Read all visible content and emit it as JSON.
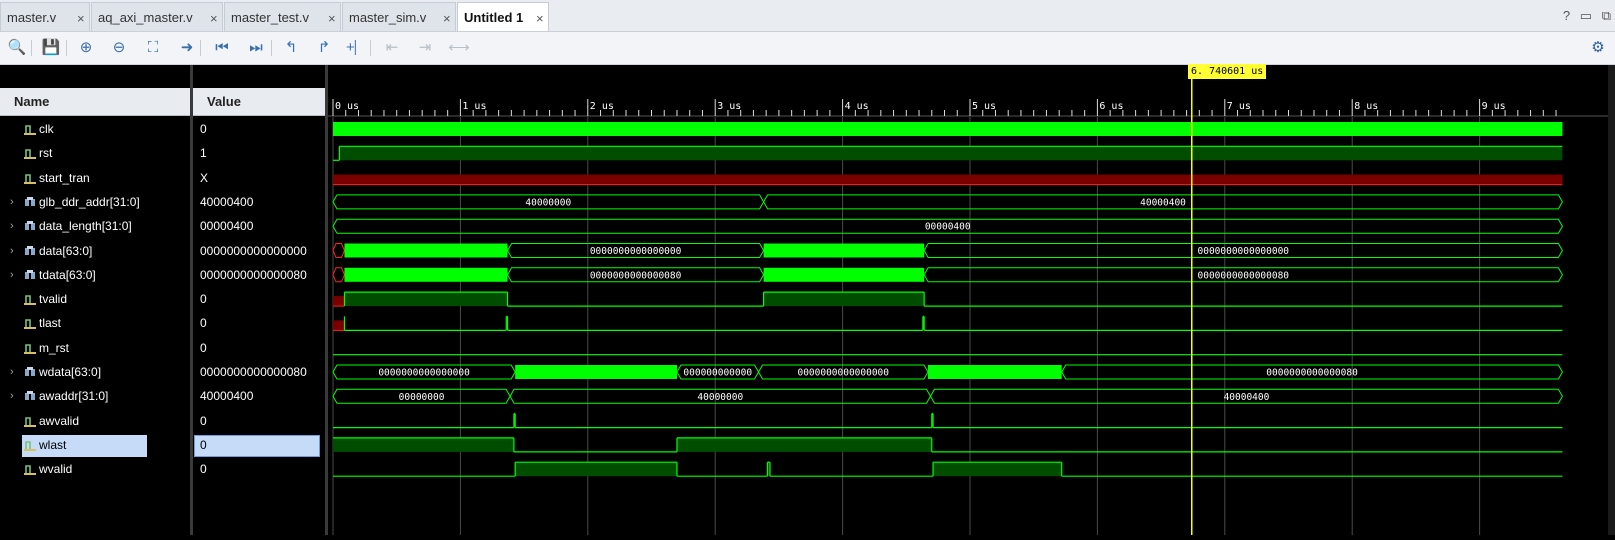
{
  "tabs": [
    {
      "label": "master.v",
      "active": false
    },
    {
      "label": "aq_axi_master.v",
      "active": false
    },
    {
      "label": "master_test.v",
      "active": false
    },
    {
      "label": "master_sim.v",
      "active": false
    },
    {
      "label": "Untitled 1",
      "active": true
    }
  ],
  "toolbar": {
    "buttons": [
      {
        "name": "search-icon",
        "glyph": "🔍",
        "enabled": true
      },
      {
        "name": "save-icon",
        "glyph": "💾",
        "enabled": true
      },
      {
        "name": "zoom-in-icon",
        "glyph": "⊕",
        "enabled": true
      },
      {
        "name": "zoom-out-icon",
        "glyph": "⊖",
        "enabled": true
      },
      {
        "name": "zoom-fit-icon",
        "glyph": "⛶",
        "enabled": true
      },
      {
        "name": "go-to-cursor-icon",
        "glyph": "➜",
        "enabled": true
      },
      {
        "name": "go-to-time-zero-icon",
        "glyph": "⏮",
        "enabled": true
      },
      {
        "name": "go-to-last-time-icon",
        "glyph": "⏭",
        "enabled": true
      },
      {
        "name": "previous-transition-icon",
        "glyph": "↰",
        "enabled": true
      },
      {
        "name": "next-transition-icon",
        "glyph": "↱",
        "enabled": true
      },
      {
        "name": "add-marker-icon",
        "glyph": "+⎸",
        "enabled": true
      },
      {
        "name": "previous-marker-icon",
        "glyph": "⇤",
        "enabled": false
      },
      {
        "name": "next-marker-icon",
        "glyph": "⇥",
        "enabled": false
      },
      {
        "name": "swap-cursors-icon",
        "glyph": "⟷",
        "enabled": false
      }
    ],
    "settings_icon": "gear-icon"
  },
  "columns": {
    "name": "Name",
    "value": "Value"
  },
  "cursor": {
    "label": "6. 740601 us",
    "time_us": 6.740601,
    "color": "#ffff00"
  },
  "timeline": {
    "start_us": 0,
    "end_us": 9.65,
    "ticks": [
      "0 us",
      "1 us",
      "2 us",
      "3 us",
      "4 us",
      "5 us",
      "6 us",
      "7 us",
      "8 us",
      "9 us"
    ]
  },
  "colors": {
    "wave": "#00ff00",
    "wave_fill": "#004d00",
    "undefined": "#ff2020",
    "undefined_fill": "#7a0000",
    "grid": "#4a4a4a",
    "selection": "#c6dbf7"
  },
  "signals": [
    {
      "name": "clk",
      "value": "0",
      "bus": false,
      "kind": "clock"
    },
    {
      "name": "rst",
      "value": "1",
      "bus": false,
      "kind": "bit",
      "segments": [
        [
          0,
          0.05,
          0
        ],
        [
          0.05,
          9.65,
          1
        ]
      ]
    },
    {
      "name": "start_tran",
      "value": "X",
      "bus": false,
      "kind": "bit",
      "segments": [
        [
          0,
          9.65,
          "X"
        ]
      ]
    },
    {
      "name": "glb_ddr_addr[31:0]",
      "value": "40000400",
      "bus": true,
      "kind": "bus",
      "segments": [
        [
          0,
          3.38,
          "40000000"
        ],
        [
          3.38,
          9.65,
          "40000400"
        ]
      ]
    },
    {
      "name": "data_length[31:0]",
      "value": "00000400",
      "bus": true,
      "kind": "bus",
      "segments": [
        [
          0,
          9.65,
          "00000400"
        ]
      ]
    },
    {
      "name": "data[63:0]",
      "value": "0000000000000000",
      "bus": true,
      "kind": "bus",
      "segments": [
        [
          0,
          0.09,
          "X"
        ],
        [
          0.09,
          1.37,
          "#"
        ],
        [
          1.37,
          3.38,
          "0000000000000000"
        ],
        [
          3.38,
          4.64,
          "#"
        ],
        [
          4.64,
          9.65,
          "0000000000000000"
        ]
      ]
    },
    {
      "name": "tdata[63:0]",
      "value": "0000000000000080",
      "bus": true,
      "kind": "bus",
      "segments": [
        [
          0,
          0.09,
          "X"
        ],
        [
          0.09,
          1.37,
          "#"
        ],
        [
          1.37,
          3.38,
          "0000000000000080"
        ],
        [
          3.38,
          4.64,
          "#"
        ],
        [
          4.64,
          9.65,
          "0000000000000080"
        ]
      ]
    },
    {
      "name": "tvalid",
      "value": "0",
      "bus": false,
      "kind": "bit",
      "segments": [
        [
          0,
          0.09,
          "X"
        ],
        [
          0.09,
          1.37,
          1
        ],
        [
          1.37,
          3.38,
          0
        ],
        [
          3.38,
          4.64,
          1
        ],
        [
          4.64,
          9.65,
          0
        ]
      ]
    },
    {
      "name": "tlast",
      "value": "0",
      "bus": false,
      "kind": "bit",
      "segments": [
        [
          0,
          0.09,
          "X"
        ],
        [
          0.09,
          1.36,
          0
        ],
        [
          1.36,
          1.37,
          1
        ],
        [
          1.37,
          4.63,
          0
        ],
        [
          4.63,
          4.64,
          1
        ],
        [
          4.64,
          9.65,
          0
        ]
      ]
    },
    {
      "name": "m_rst",
      "value": "0",
      "bus": false,
      "kind": "bit",
      "segments": [
        [
          0,
          9.65,
          0
        ]
      ]
    },
    {
      "name": "wdata[63:0]",
      "value": "0000000000000080",
      "bus": true,
      "kind": "bus",
      "segments": [
        [
          0,
          1.43,
          "0000000000000000"
        ],
        [
          1.43,
          2.7,
          "#"
        ],
        [
          2.7,
          3.34,
          "000000000000"
        ],
        [
          3.34,
          4.67,
          "0000000000000000"
        ],
        [
          4.67,
          5.72,
          "#"
        ],
        [
          5.72,
          9.65,
          "0000000000000080"
        ]
      ]
    },
    {
      "name": "awaddr[31:0]",
      "value": "40000400",
      "bus": true,
      "kind": "bus",
      "segments": [
        [
          0,
          1.39,
          "00000000"
        ],
        [
          1.39,
          4.69,
          "40000000"
        ],
        [
          4.69,
          9.65,
          "40000400"
        ]
      ]
    },
    {
      "name": "awvalid",
      "value": "0",
      "bus": false,
      "kind": "bit",
      "segments": [
        [
          0,
          1.42,
          0
        ],
        [
          1.42,
          1.43,
          1
        ],
        [
          1.43,
          4.7,
          0
        ],
        [
          4.7,
          4.71,
          1
        ],
        [
          4.71,
          9.65,
          0
        ]
      ]
    },
    {
      "name": "wlast",
      "value": "0",
      "bus": false,
      "kind": "bit",
      "selected": true,
      "segments": [
        [
          0,
          1.42,
          1
        ],
        [
          1.42,
          2.7,
          0
        ],
        [
          2.7,
          4.7,
          1
        ],
        [
          4.7,
          9.65,
          0
        ]
      ]
    },
    {
      "name": "wvalid",
      "value": "0",
      "bus": false,
      "kind": "bit",
      "segments": [
        [
          0,
          1.43,
          0
        ],
        [
          1.43,
          2.7,
          1
        ],
        [
          2.7,
          3.41,
          0
        ],
        [
          3.41,
          3.43,
          1
        ],
        [
          3.43,
          4.71,
          0
        ],
        [
          4.71,
          5.72,
          1
        ],
        [
          5.72,
          9.65,
          0
        ]
      ]
    }
  ]
}
